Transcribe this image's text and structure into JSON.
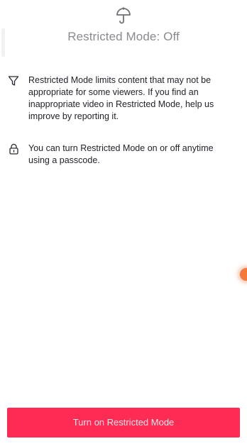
{
  "header": {
    "icon": "umbrella-icon",
    "title": "Restricted Mode: Off"
  },
  "info": {
    "items": [
      {
        "icon": "filter-icon",
        "text": "Restricted Mode limits content that may not be appropriate for some viewers. If you find an inappropriate video in Restricted Mode, help us improve by reporting it."
      },
      {
        "icon": "lock-icon",
        "text": "You can turn Restricted Mode on or off anytime using a passcode."
      }
    ]
  },
  "footer": {
    "button_label": "Turn on Restricted Mode"
  },
  "colors": {
    "accent": "#fe2c55",
    "title_gray": "#8a8b91",
    "body_text": "#1f1f28"
  }
}
